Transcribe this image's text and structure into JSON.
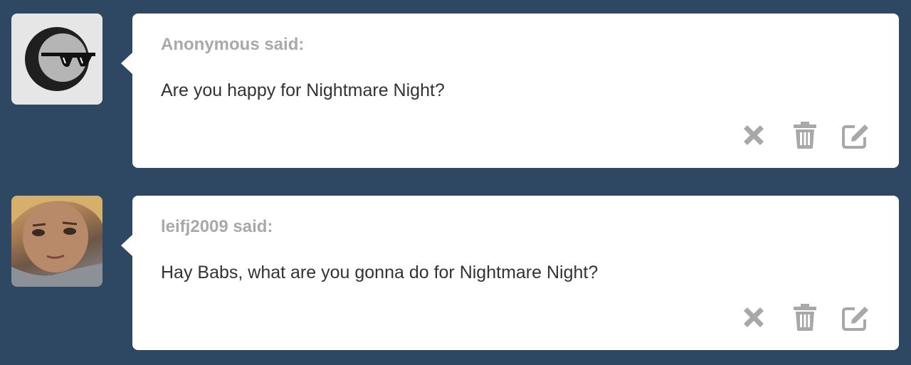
{
  "messages": [
    {
      "asker": "Anonymous said:",
      "question": "Are you happy for Nightmare Night?",
      "avatar": "anonymous-sunglasses-avatar",
      "actions": [
        "delete-x-icon",
        "trash-icon",
        "edit-icon"
      ]
    },
    {
      "asker": "leifj2009 said:",
      "question": "Hay Babs, what are you gonna do for Nightmare Night?",
      "avatar": "user-photo-avatar",
      "actions": [
        "delete-x-icon",
        "trash-icon",
        "edit-icon"
      ]
    }
  ],
  "colors": {
    "background": "#2e4864",
    "bubble": "#ffffff",
    "asker_text": "#a9a9a9",
    "question_text": "#333333",
    "icon": "#a8a8a8"
  }
}
